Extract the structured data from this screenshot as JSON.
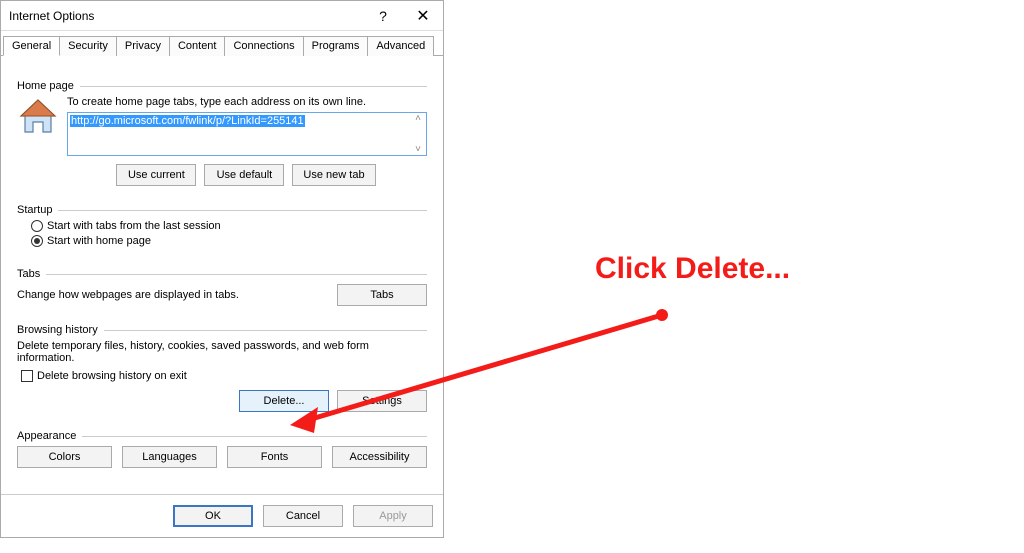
{
  "dialog": {
    "title": "Internet Options",
    "help_glyph": "?",
    "close_glyph": "✕"
  },
  "tabs": {
    "items": [
      "General",
      "Security",
      "Privacy",
      "Content",
      "Connections",
      "Programs",
      "Advanced"
    ],
    "active": "General"
  },
  "home_page": {
    "group_label": "Home page",
    "instruction": "To create home page tabs, type each address on its own line.",
    "url": "http://go.microsoft.com/fwlink/p/?LinkId=255141",
    "use_current": "Use current",
    "use_default": "Use default",
    "use_new_tab": "Use new tab"
  },
  "startup": {
    "group_label": "Startup",
    "option_last": "Start with tabs from the last session",
    "option_home": "Start with home page",
    "selected": "home"
  },
  "tabs_section": {
    "group_label": "Tabs",
    "text": "Change how webpages are displayed in tabs.",
    "button": "Tabs"
  },
  "history": {
    "group_label": "Browsing history",
    "text": "Delete temporary files, history, cookies, saved passwords, and web form information.",
    "check_label": "Delete browsing history on exit",
    "checked": false,
    "delete_btn": "Delete...",
    "settings_btn": "Settings"
  },
  "appearance": {
    "group_label": "Appearance",
    "colors": "Colors",
    "languages": "Languages",
    "fonts": "Fonts",
    "accessibility": "Accessibility"
  },
  "bottom": {
    "ok": "OK",
    "cancel": "Cancel",
    "apply": "Apply"
  },
  "annotation": {
    "text": "Click Delete..."
  }
}
